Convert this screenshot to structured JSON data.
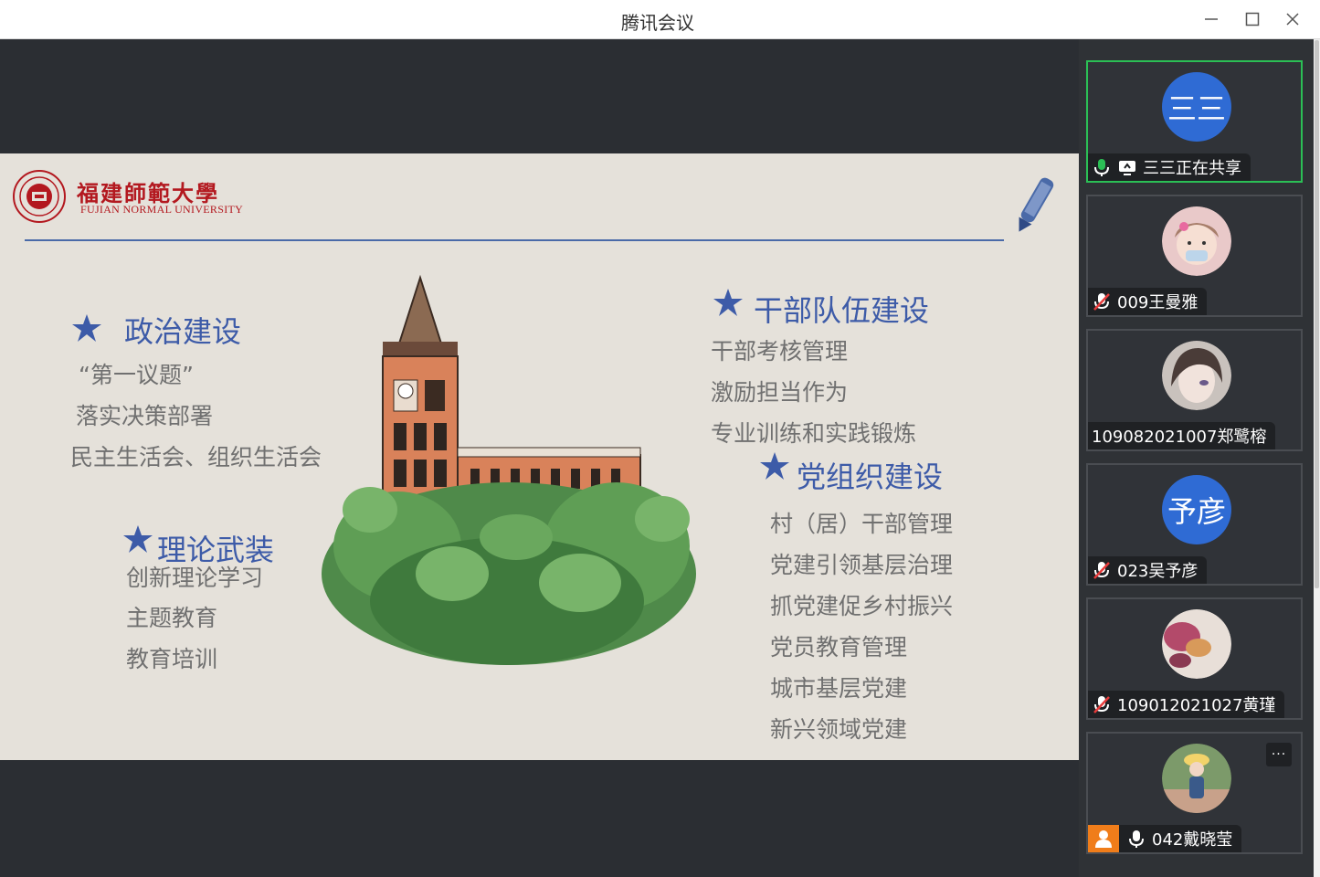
{
  "window": {
    "title": "腾讯会议",
    "minimize_icon": "minimize-icon",
    "maximize_icon": "maximize-icon",
    "close_icon": "close-icon"
  },
  "slide": {
    "university_cn": "福建師範大學",
    "university_en": "FUJIAN NORMAL UNIVERSITY",
    "sections": [
      {
        "heading": "政治建设",
        "items": [
          "“第一议题”",
          "落实决策部署",
          "民主生活会、组织生活会"
        ]
      },
      {
        "heading": "理论武装",
        "items": [
          "创新理论学习",
          "主题教育",
          "教育培训"
        ]
      },
      {
        "heading": "干部队伍建设",
        "items": [
          "干部考核管理",
          "激励担当作为",
          "专业训练和实践锻炼"
        ]
      },
      {
        "heading": "党组织建设",
        "items": [
          "村（居）干部管理",
          "党建引领基层治理",
          "抓党建促乡村振兴",
          "党员教育管理",
          "城市基层党建",
          "新兴领域党建"
        ]
      }
    ],
    "accent_color": "#3d5ba8",
    "brand_color": "#b3181f"
  },
  "participants": [
    {
      "avatar_text": "三三",
      "name": "三三正在共享",
      "mic": "mic-on",
      "sharing": true,
      "active": true
    },
    {
      "avatar_text": "",
      "name": "009王曼雅",
      "mic": "mic-muted"
    },
    {
      "avatar_text": "",
      "name": "10908202​1007郑鹭榕",
      "mic": "none"
    },
    {
      "avatar_text": "予彦",
      "name": "023吴予彦",
      "mic": "mic-muted"
    },
    {
      "avatar_text": "",
      "name": "109012021027黄瑾",
      "mic": "mic-muted"
    },
    {
      "avatar_text": "",
      "name": "042戴晓莹",
      "mic": "mic-on",
      "host": true,
      "more": "···"
    }
  ]
}
